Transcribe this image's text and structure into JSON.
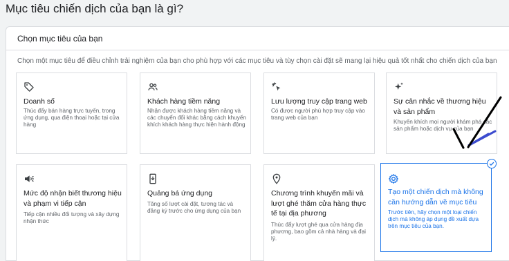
{
  "page": {
    "heading": "Mục tiêu chiến dịch của bạn là gì?"
  },
  "panel": {
    "title": "Chọn mục tiêu của bạn",
    "description": "Chọn một mục tiêu để điều chỉnh trải nghiệm của bạn cho phù hợp với các mục tiêu và tùy chọn cài đặt sẽ mang lại hiệu quả tốt nhất cho chiến dịch của bạn"
  },
  "goals": [
    {
      "icon": "tag-icon",
      "title": "Doanh số",
      "description": "Thúc đẩy bán hàng trực tuyến, trong ứng dụng, qua điện thoại hoặc tại cửa hàng"
    },
    {
      "icon": "people-icon",
      "title": "Khách hàng tiềm năng",
      "description": "Nhận được khách hàng tiềm năng và các chuyển đổi khác bằng cách khuyến khích khách hàng thực hiện hành động"
    },
    {
      "icon": "cursor-click-icon",
      "title": "Lưu lượng truy cập trang web",
      "description": "Có được người phù hợp truy cập vào trang web của bạn"
    },
    {
      "icon": "sparkle-icon",
      "title": "Sự cân nhắc về thương hiệu và sản phẩm",
      "description": "Khuyến khích mọi người khám phá các sản phẩm hoặc dịch vụ của bạn"
    },
    {
      "icon": "megaphone-icon",
      "title": "Mức độ nhận biết thương hiệu và phạm vi tiếp cận",
      "description": "Tiếp cận nhiều đối tượng và xây dựng nhận thức"
    },
    {
      "icon": "phone-download-icon",
      "title": "Quảng bá ứng dụng",
      "description": "Tăng số lượt cài đặt, tương tác và đăng ký trước cho ứng dụng của bạn"
    },
    {
      "icon": "location-pin-icon",
      "title": "Chương trình khuyến mãi và lượt ghé thăm cửa hàng thực tế tại địa phương",
      "description": "Thúc đẩy lượt ghé qua cửa hàng địa phương, bao gồm cả nhà hàng và đại lý."
    },
    {
      "icon": "gear-icon",
      "title": "Tạo một chiến dịch mà không cần hướng dẫn về mục tiêu",
      "description": "Trước tiên, hãy chọn một loại chiến dịch mà không áp dụng đề xuất dựa trên mục tiêu của bạn.",
      "selected": true
    }
  ],
  "colors": {
    "accent": "#1a73e8",
    "annotation_stroke": "#000000",
    "annotation_highlight": "#3c4ccf"
  }
}
